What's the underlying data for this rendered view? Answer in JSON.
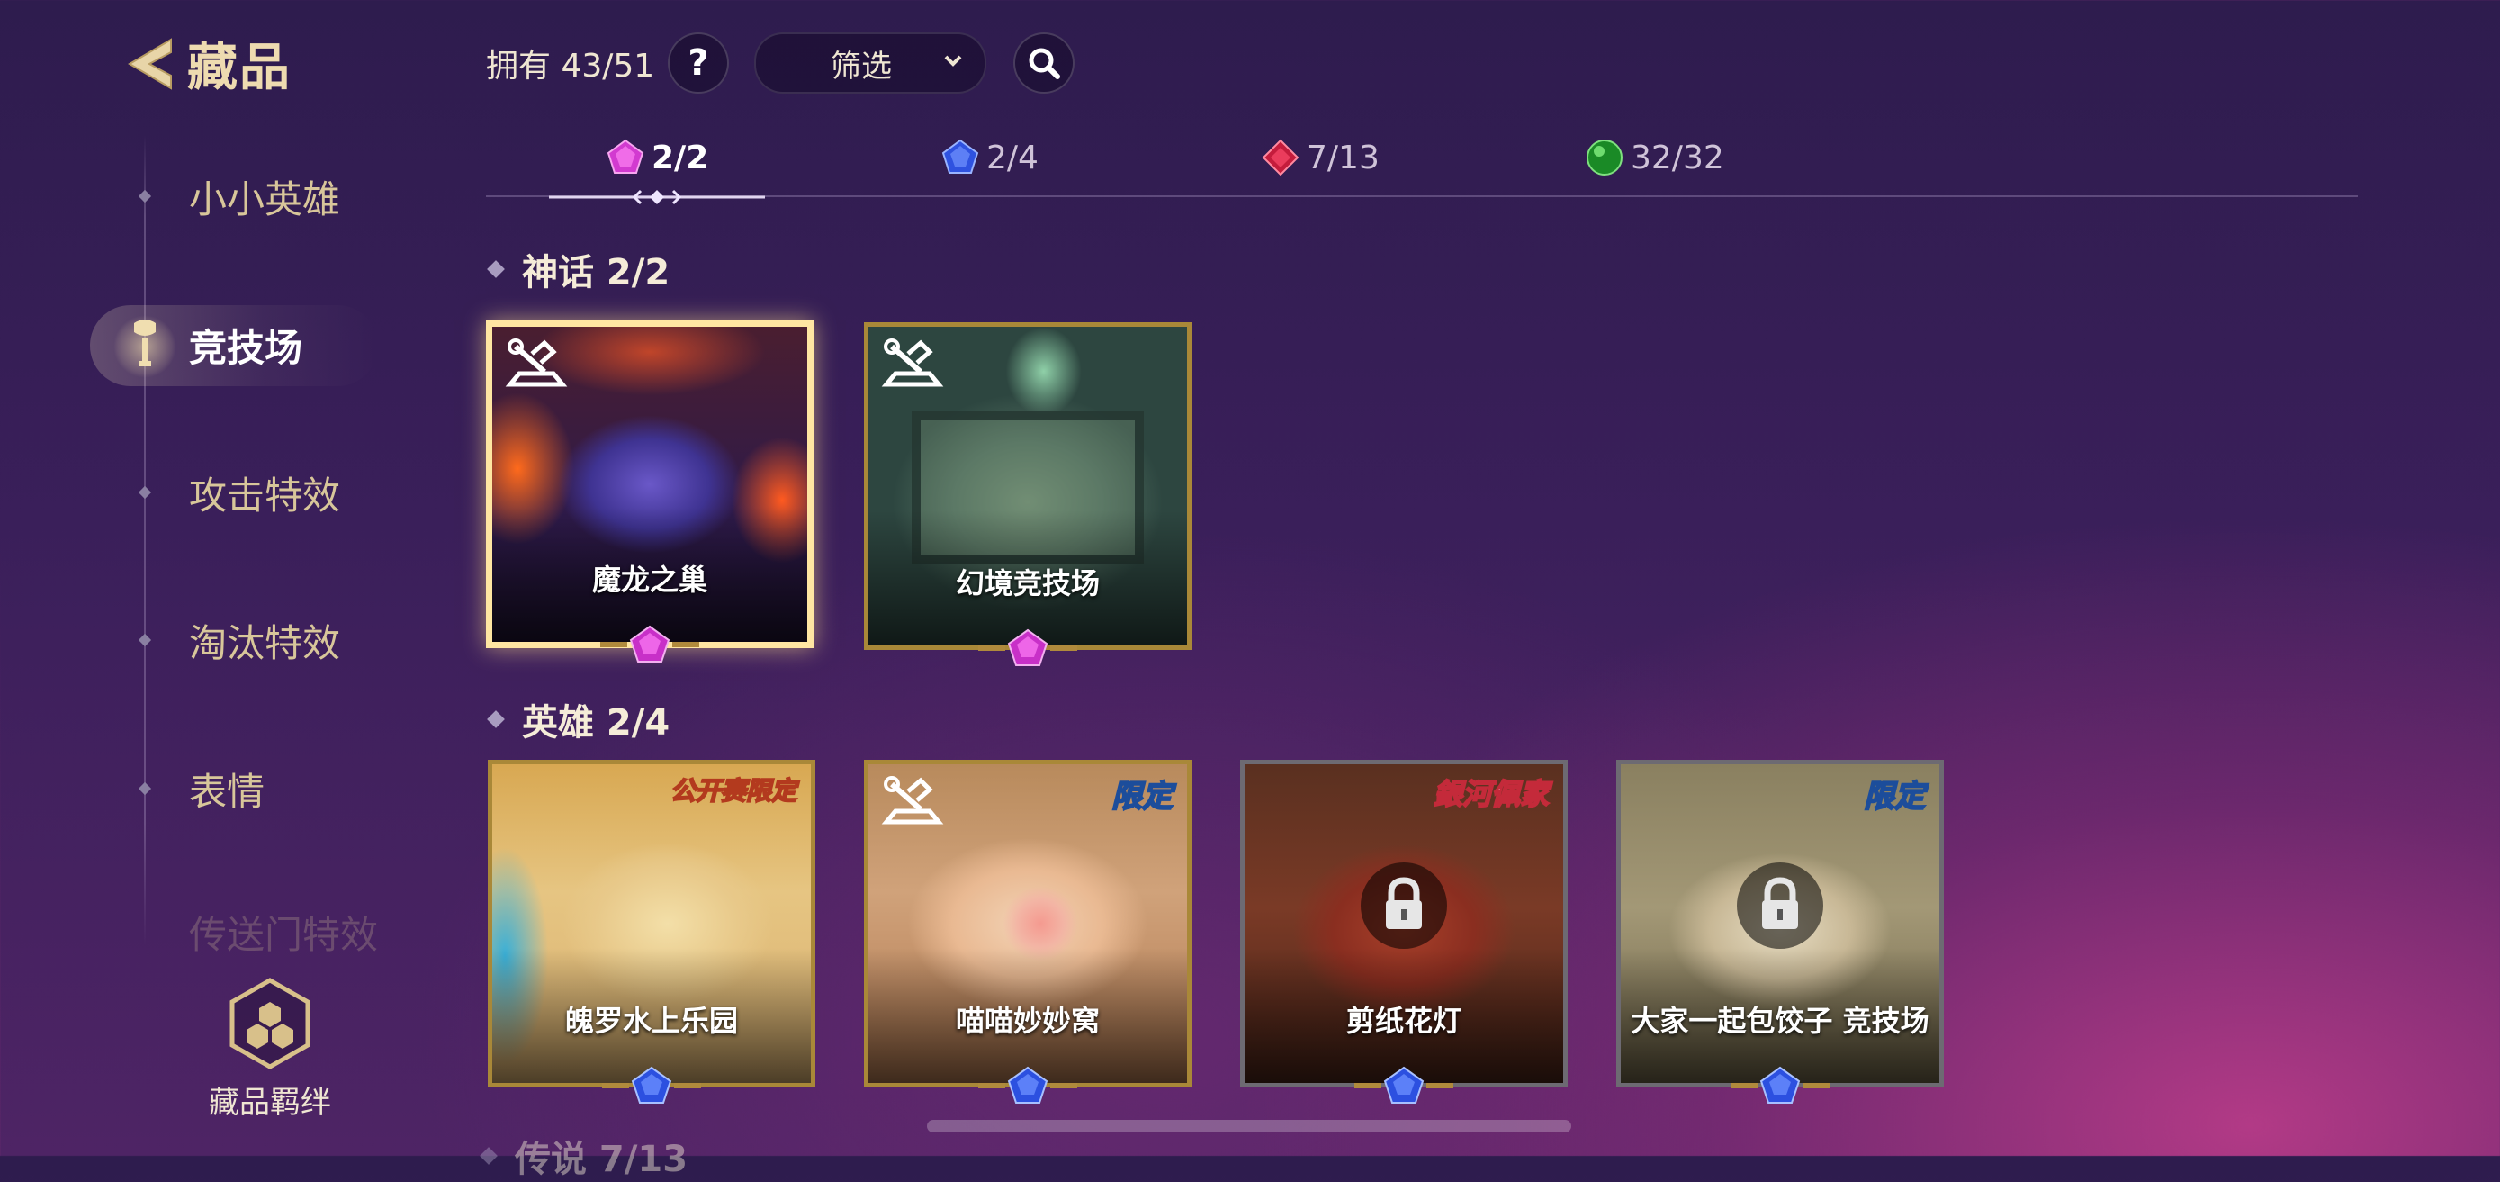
{
  "header": {
    "title": "藏品"
  },
  "sidebar": {
    "items": [
      {
        "label": "小小英雄"
      },
      {
        "label": "竞技场"
      },
      {
        "label": "攻击特效"
      },
      {
        "label": "淘汰特效"
      },
      {
        "label": "表情"
      },
      {
        "label": "传送门特效"
      }
    ],
    "bond_label": "藏品羁绊"
  },
  "toolbar": {
    "owned": "拥有 43/51",
    "help": "?",
    "filter": "筛选"
  },
  "tabs": [
    {
      "count": "2/2",
      "gem": "mythic-gem-icon",
      "color": "#d23ad0"
    },
    {
      "count": "2/4",
      "gem": "epic-gem-icon",
      "color": "#3a5ef0"
    },
    {
      "count": "7/13",
      "gem": "legendary-gem-icon",
      "color": "#d22040"
    },
    {
      "count": "32/32",
      "gem": "common-orb-icon",
      "color": "#22a030"
    }
  ],
  "sections": {
    "mythic": {
      "title": "神话 2/2",
      "cards": [
        {
          "name": "魔龙之巢"
        },
        {
          "name": "幻境竞技场"
        }
      ]
    },
    "hero": {
      "title": "英雄 2/4",
      "cards": [
        {
          "name": "魄罗水上乐园",
          "badge": "公开赛限定"
        },
        {
          "name": "喵喵妙妙窝",
          "badge": "限定"
        },
        {
          "name": "剪纸花灯",
          "badge": "銀河佩家"
        },
        {
          "name": "大家一起包饺子 竞技场",
          "badge": "限定"
        }
      ]
    },
    "next": {
      "title": "传说 7/13"
    }
  }
}
